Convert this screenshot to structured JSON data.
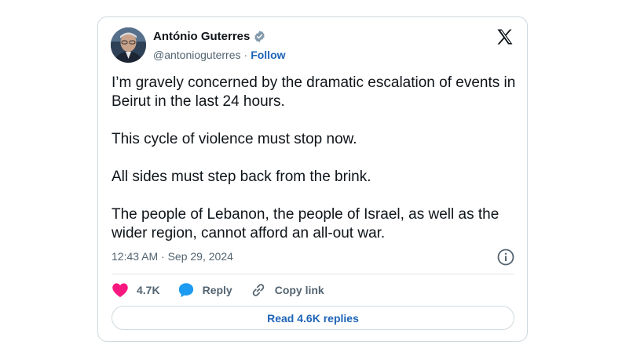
{
  "author": {
    "name": "António Guterres",
    "handle": "@antonioguterres",
    "separator": "·",
    "follow_label": "Follow"
  },
  "post": {
    "text": "I’m gravely concerned by the dramatic escalation of events in Beirut in the last 24 hours.\n\nThis cycle of violence must stop now.\n\nAll sides must step back from the brink.\n\nThe people of Lebanon, the people of Israel, as well as the wider region, cannot afford an all-out war.",
    "timestamp": "12:43 AM · Sep 29, 2024"
  },
  "actions": {
    "like_count": "4.7K",
    "reply_label": "Reply",
    "copy_link_label": "Copy link"
  },
  "read_replies_label": "Read 4.6K replies",
  "icons": {
    "verified": "verified-badge-icon",
    "x_logo": "x-logo-icon",
    "info": "info-icon",
    "like": "heart-icon",
    "reply": "speech-bubble-icon",
    "copy_link": "link-icon"
  },
  "colors": {
    "like": "#f91880",
    "reply": "#1d9bf0",
    "link_text": "#1d63b8",
    "secondary_text": "#536471"
  }
}
